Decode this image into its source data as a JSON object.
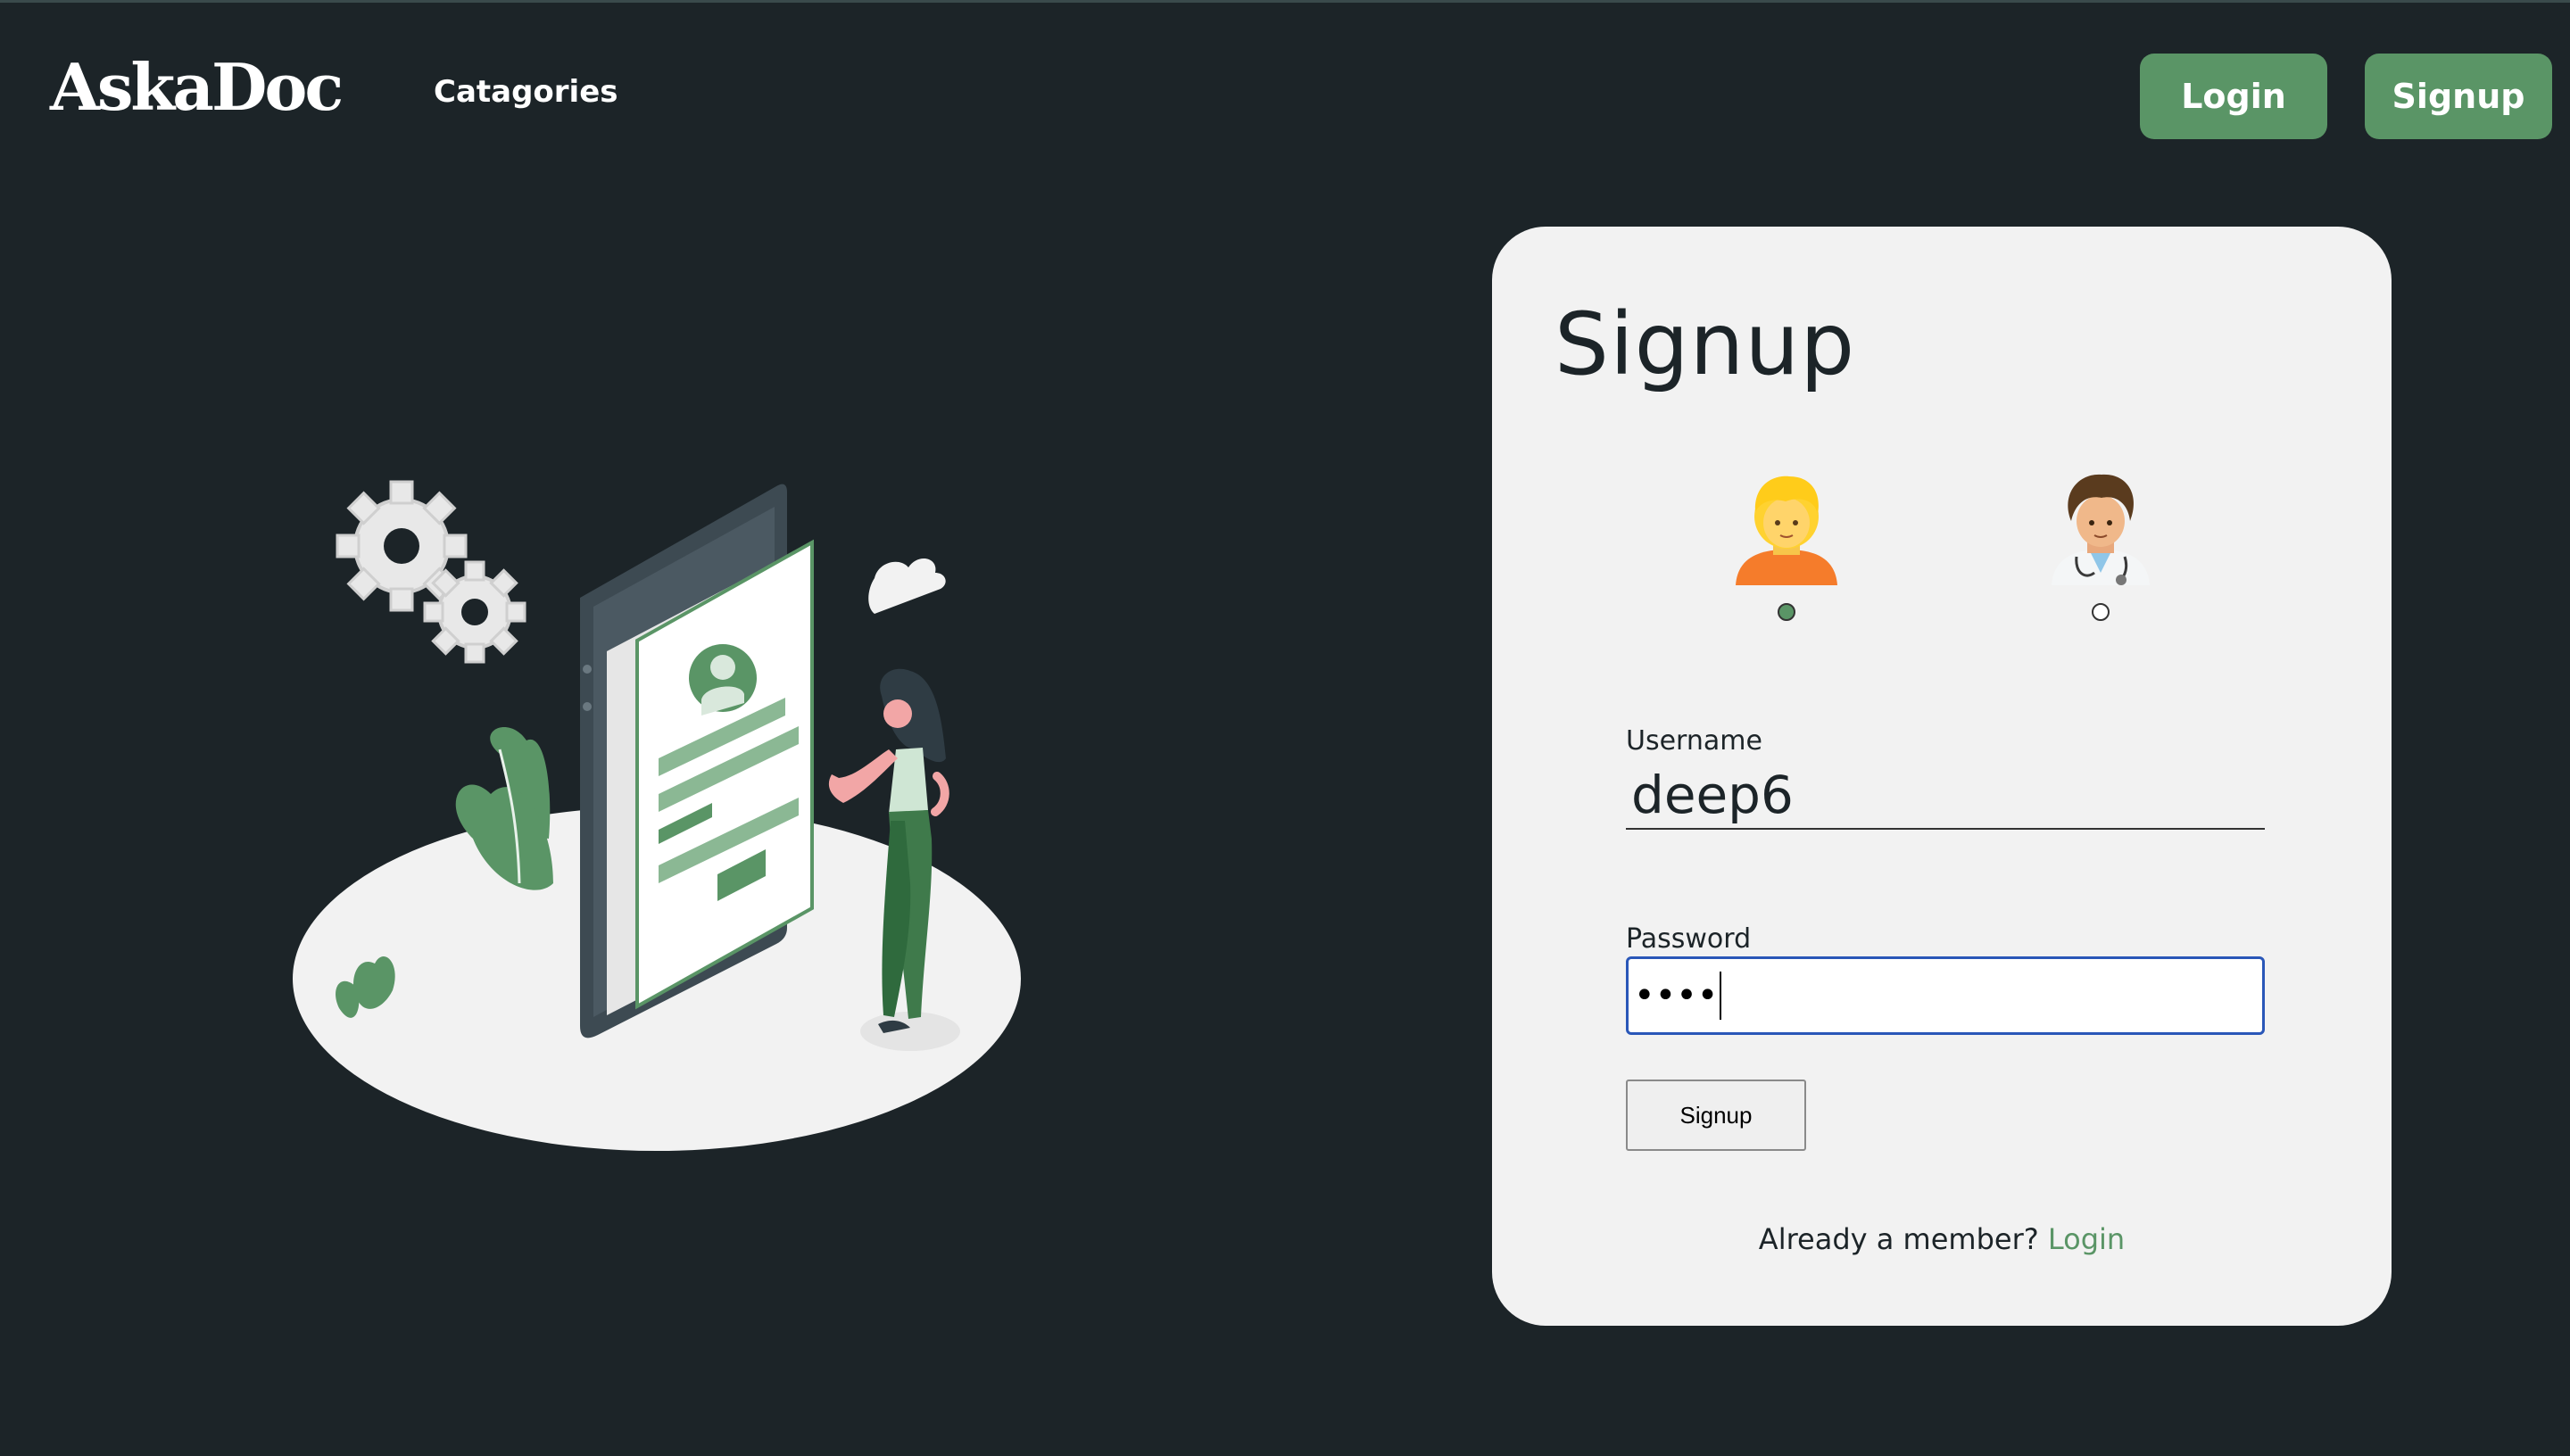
{
  "header": {
    "logo": "AskaDoc",
    "nav_link": "Catagories",
    "login_label": "Login",
    "signup_label": "Signup"
  },
  "form": {
    "title": "Signup",
    "roles": [
      {
        "name": "patient",
        "icon": "patient-emoji-icon",
        "selected": true
      },
      {
        "name": "doctor",
        "icon": "doctor-emoji-icon",
        "selected": false
      }
    ],
    "username_label": "Username",
    "username_value": "deep6",
    "password_label": "Password",
    "password_masked": "••••",
    "submit_label": "Signup",
    "member_text": "Already a member?",
    "member_link": "Login"
  },
  "colors": {
    "background": "#1c2428",
    "accent": "#5a9566",
    "card": "#f2f2f2",
    "focus_border": "#2a57b8"
  }
}
